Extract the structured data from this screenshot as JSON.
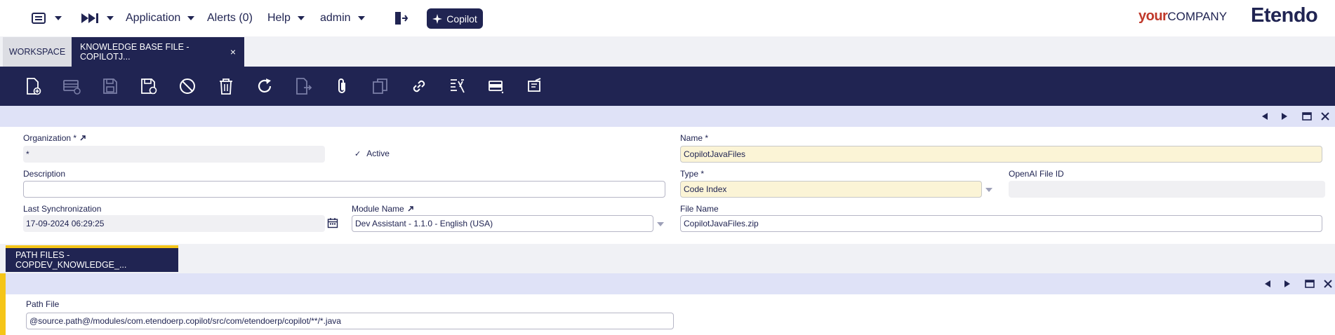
{
  "nav": {
    "application": "Application",
    "alerts": "Alerts (0)",
    "help": "Help",
    "user": "admin",
    "copilot": "Copilot"
  },
  "brand": {
    "your": "your",
    "company": "COMPANY",
    "etendo": "Etendo"
  },
  "tabs": {
    "workspace": "WORKSPACE",
    "active": "KNOWLEDGE BASE FILE - COPILOTJ...",
    "close": "×"
  },
  "toolbar": {
    "icons": [
      "new-record-icon",
      "new-row-icon",
      "save-icon",
      "save-close-icon",
      "cancel-icon",
      "delete-icon",
      "refresh-icon",
      "export-icon",
      "attachment-icon",
      "clone-icon",
      "link-icon",
      "filter-icon",
      "grid-view-icon",
      "notes-icon"
    ]
  },
  "form": {
    "organization": {
      "label": "Organization *",
      "value": "*"
    },
    "active": {
      "label": "Active",
      "checked": true
    },
    "name": {
      "label": "Name *",
      "value": "CopilotJavaFiles"
    },
    "description": {
      "label": "Description",
      "value": ""
    },
    "type": {
      "label": "Type *",
      "value": "Code Index"
    },
    "openai_file_id": {
      "label": "OpenAI File ID",
      "value": ""
    },
    "last_sync": {
      "label": "Last Synchronization",
      "value": "17-09-2024 06:29:25"
    },
    "module_name": {
      "label": "Module Name",
      "value": "Dev Assistant - 1.1.0 - English (USA)"
    },
    "file_name": {
      "label": "File Name",
      "value": "CopilotJavaFiles.zip"
    }
  },
  "subtab": {
    "label": "PATH FILES - COPDEV_KNOWLEDGE_...",
    "path_file": {
      "label": "Path File",
      "value": "@source.path@/modules/com.etendoerp.copilot/src/com/etendoerp/copilot/**/*.java"
    }
  },
  "colors": {
    "navy": "#202452",
    "section_bar": "#dfe2f7",
    "required_field": "#fbf4d6",
    "accent_yellow": "#f5c518"
  }
}
